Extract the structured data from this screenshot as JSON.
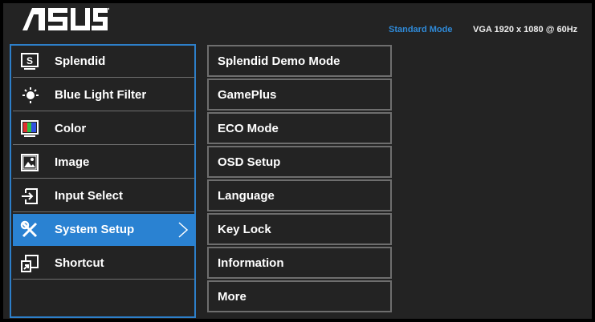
{
  "header": {
    "brand": "ASUS",
    "mode": "Standard Mode",
    "input_resolution": "VGA  1920 x 1080 @ 60Hz"
  },
  "colors": {
    "accent": "#2a82d2",
    "background": "#232323",
    "border": "#6e6e6e"
  },
  "main_menu": {
    "items": [
      {
        "label": "Splendid",
        "icon": "splendid-icon"
      },
      {
        "label": "Blue Light Filter",
        "icon": "blue-light-filter-icon"
      },
      {
        "label": "Color",
        "icon": "color-icon"
      },
      {
        "label": "Image",
        "icon": "image-icon"
      },
      {
        "label": "Input Select",
        "icon": "input-select-icon"
      },
      {
        "label": "System Setup",
        "icon": "system-setup-icon",
        "selected": true
      },
      {
        "label": "Shortcut",
        "icon": "shortcut-icon"
      }
    ]
  },
  "submenu": {
    "items": [
      {
        "label": "Splendid Demo Mode"
      },
      {
        "label": "GamePlus"
      },
      {
        "label": "ECO Mode"
      },
      {
        "label": "OSD Setup"
      },
      {
        "label": "Language"
      },
      {
        "label": "Key Lock"
      },
      {
        "label": "Information"
      },
      {
        "label": "More"
      }
    ]
  }
}
